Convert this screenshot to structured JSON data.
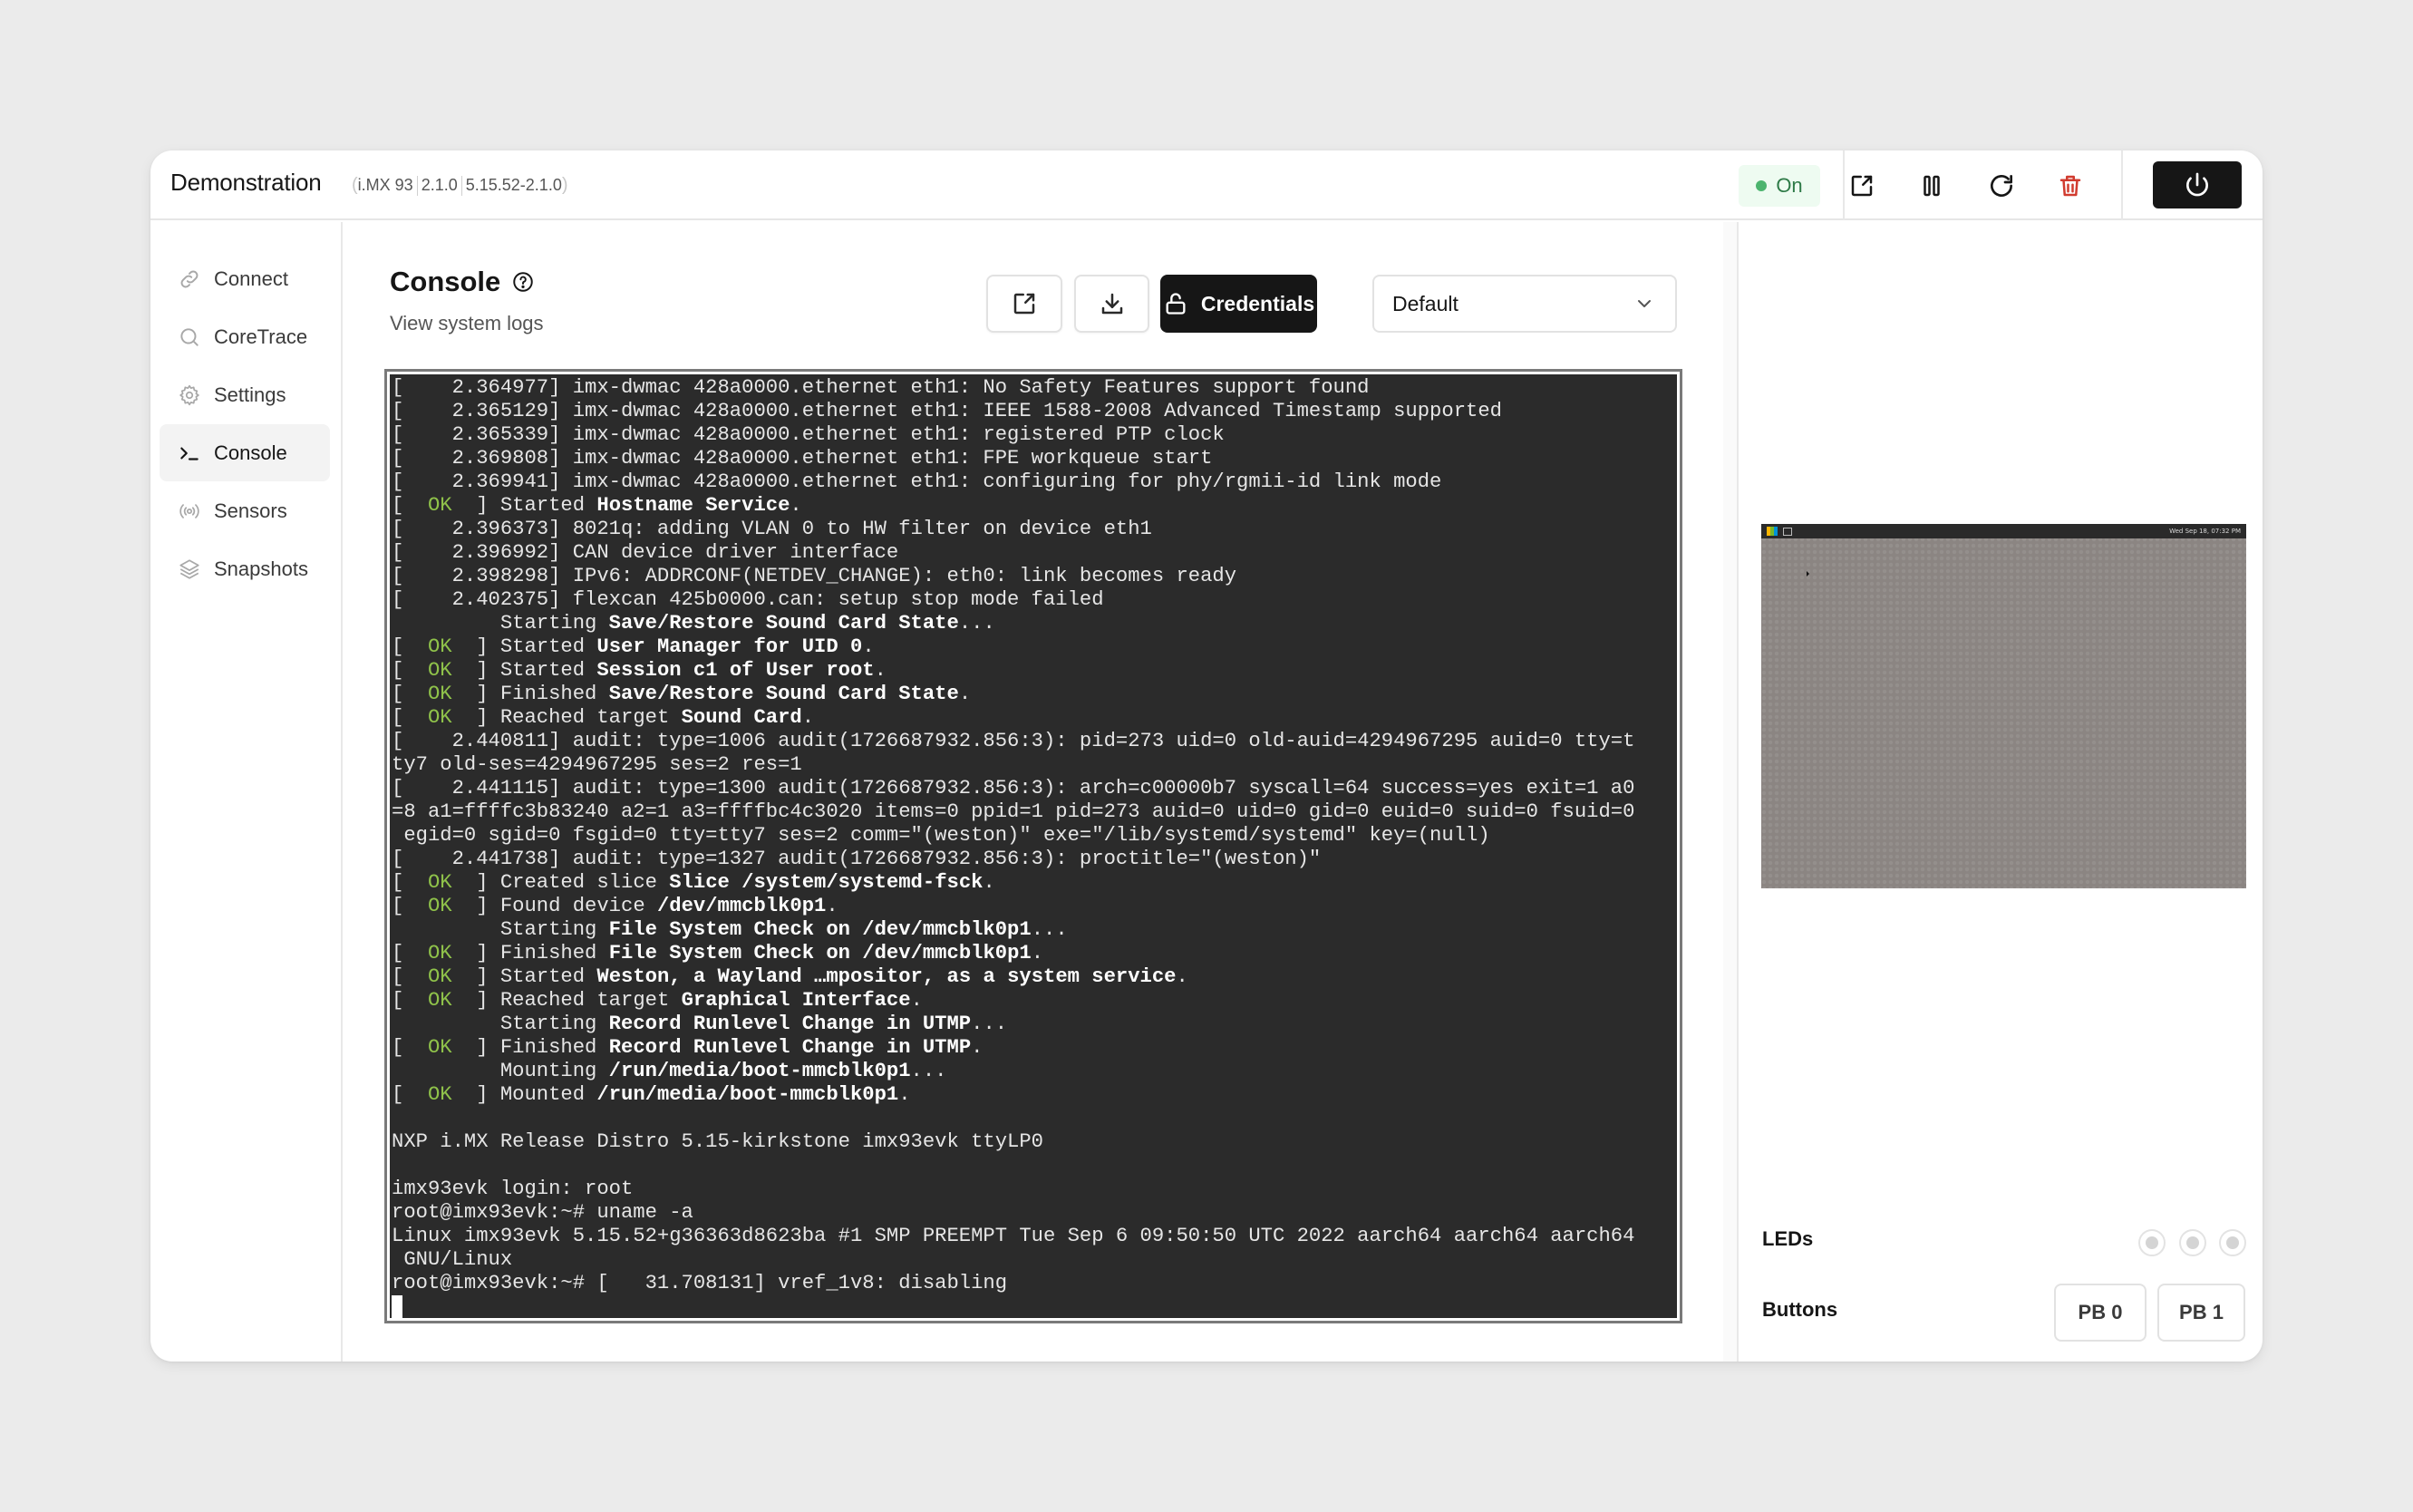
{
  "header": {
    "title": "Demonstration",
    "meta": [
      "i.MX 93",
      "2.1.0",
      "5.15.52-2.1.0"
    ],
    "status": {
      "label": "On",
      "color": "#4cb46e"
    },
    "actions": [
      {
        "name": "open-external",
        "icon": "external-link-icon"
      },
      {
        "name": "pause",
        "icon": "pause-icon"
      },
      {
        "name": "restart",
        "icon": "refresh-icon"
      },
      {
        "name": "delete",
        "icon": "trash-icon",
        "color": "#d13b2f"
      }
    ],
    "power_icon": "power-icon"
  },
  "sidebar": {
    "items": [
      {
        "label": "Connect",
        "icon": "link-icon",
        "active": false
      },
      {
        "label": "CoreTrace",
        "icon": "search-icon",
        "active": false
      },
      {
        "label": "Settings",
        "icon": "gear-icon",
        "active": false
      },
      {
        "label": "Console",
        "icon": "terminal-icon",
        "active": true
      },
      {
        "label": "Sensors",
        "icon": "broadcast-icon",
        "active": false
      },
      {
        "label": "Snapshots",
        "icon": "layers-icon",
        "active": false
      }
    ]
  },
  "main": {
    "title": "Console",
    "subtitle": "View system logs",
    "toolbar": {
      "credentials_label": "Credentials",
      "select_value": "Default"
    },
    "terminal": {
      "lines": [
        [
          {
            "t": "[    2.364977] imx-dwmac 428a0000.ethernet eth1: No Safety Features support found"
          }
        ],
        [
          {
            "t": "[    2.365129] imx-dwmac 428a0000.ethernet eth1: IEEE 1588-2008 Advanced Timestamp supported"
          }
        ],
        [
          {
            "t": "[    2.365339] imx-dwmac 428a0000.ethernet eth1: registered PTP clock"
          }
        ],
        [
          {
            "t": "[    2.369808] imx-dwmac 428a0000.ethernet eth1: FPE workqueue start"
          }
        ],
        [
          {
            "t": "[    2.369941] imx-dwmac 428a0000.ethernet eth1: configuring for phy/rgmii-id link mode"
          }
        ],
        [
          {
            "t": "[  "
          },
          {
            "t": "OK",
            "s": "ok"
          },
          {
            "t": "  ] Started "
          },
          {
            "t": "Hostname Service",
            "s": "b"
          },
          {
            "t": "."
          }
        ],
        [
          {
            "t": "[    2.396373] 8021q: adding VLAN 0 to HW filter on device eth1"
          }
        ],
        [
          {
            "t": "[    2.396992] CAN device driver interface"
          }
        ],
        [
          {
            "t": "[    2.398298] IPv6: ADDRCONF(NETDEV_CHANGE): eth0: link becomes ready"
          }
        ],
        [
          {
            "t": "[    2.402375] flexcan 425b0000.can: setup stop mode failed"
          }
        ],
        [
          {
            "t": "         Starting "
          },
          {
            "t": "Save/Restore Sound Card State",
            "s": "b"
          },
          {
            "t": "..."
          }
        ],
        [
          {
            "t": "[  "
          },
          {
            "t": "OK",
            "s": "ok"
          },
          {
            "t": "  ] Started "
          },
          {
            "t": "User Manager for UID 0",
            "s": "b"
          },
          {
            "t": "."
          }
        ],
        [
          {
            "t": "[  "
          },
          {
            "t": "OK",
            "s": "ok"
          },
          {
            "t": "  ] Started "
          },
          {
            "t": "Session c1 of User root",
            "s": "b"
          },
          {
            "t": "."
          }
        ],
        [
          {
            "t": "[  "
          },
          {
            "t": "OK",
            "s": "ok"
          },
          {
            "t": "  ] Finished "
          },
          {
            "t": "Save/Restore Sound Card State",
            "s": "b"
          },
          {
            "t": "."
          }
        ],
        [
          {
            "t": "[  "
          },
          {
            "t": "OK",
            "s": "ok"
          },
          {
            "t": "  ] Reached target "
          },
          {
            "t": "Sound Card",
            "s": "b"
          },
          {
            "t": "."
          }
        ],
        [
          {
            "t": "[    2.440811] audit: type=1006 audit(1726687932.856:3): pid=273 uid=0 old-auid=4294967295 auid=0 tty=t"
          }
        ],
        [
          {
            "t": "ty7 old-ses=4294967295 ses=2 res=1"
          }
        ],
        [
          {
            "t": "[    2.441115] audit: type=1300 audit(1726687932.856:3): arch=c00000b7 syscall=64 success=yes exit=1 a0"
          }
        ],
        [
          {
            "t": "=8 a1=ffffc3b83240 a2=1 a3=ffffbc4c3020 items=0 ppid=1 pid=273 auid=0 uid=0 gid=0 euid=0 suid=0 fsuid=0"
          }
        ],
        [
          {
            "t": " egid=0 sgid=0 fsgid=0 tty=tty7 ses=2 comm=\"(weston)\" exe=\"/lib/systemd/systemd\" key=(null)"
          }
        ],
        [
          {
            "t": "[    2.441738] audit: type=1327 audit(1726687932.856:3): proctitle=\"(weston)\""
          }
        ],
        [
          {
            "t": "[  "
          },
          {
            "t": "OK",
            "s": "ok"
          },
          {
            "t": "  ] Created slice "
          },
          {
            "t": "Slice /system/systemd-fsck",
            "s": "b"
          },
          {
            "t": "."
          }
        ],
        [
          {
            "t": "[  "
          },
          {
            "t": "OK",
            "s": "ok"
          },
          {
            "t": "  ] Found device "
          },
          {
            "t": "/dev/mmcblk0p1",
            "s": "b"
          },
          {
            "t": "."
          }
        ],
        [
          {
            "t": "         Starting "
          },
          {
            "t": "File System Check on /dev/mmcblk0p1",
            "s": "b"
          },
          {
            "t": "..."
          }
        ],
        [
          {
            "t": "[  "
          },
          {
            "t": "OK",
            "s": "ok"
          },
          {
            "t": "  ] Finished "
          },
          {
            "t": "File System Check on /dev/mmcblk0p1",
            "s": "b"
          },
          {
            "t": "."
          }
        ],
        [
          {
            "t": "[  "
          },
          {
            "t": "OK",
            "s": "ok"
          },
          {
            "t": "  ] Started "
          },
          {
            "t": "Weston, a Wayland …mpositor, as a system service",
            "s": "b"
          },
          {
            "t": "."
          }
        ],
        [
          {
            "t": "[  "
          },
          {
            "t": "OK",
            "s": "ok"
          },
          {
            "t": "  ] Reached target "
          },
          {
            "t": "Graphical Interface",
            "s": "b"
          },
          {
            "t": "."
          }
        ],
        [
          {
            "t": "         Starting "
          },
          {
            "t": "Record Runlevel Change in UTMP",
            "s": "b"
          },
          {
            "t": "..."
          }
        ],
        [
          {
            "t": "[  "
          },
          {
            "t": "OK",
            "s": "ok"
          },
          {
            "t": "  ] Finished "
          },
          {
            "t": "Record Runlevel Change in UTMP",
            "s": "b"
          },
          {
            "t": "."
          }
        ],
        [
          {
            "t": "         Mounting "
          },
          {
            "t": "/run/media/boot-mmcblk0p1",
            "s": "b"
          },
          {
            "t": "..."
          }
        ],
        [
          {
            "t": "[  "
          },
          {
            "t": "OK",
            "s": "ok"
          },
          {
            "t": "  ] Mounted "
          },
          {
            "t": "/run/media/boot-mmcblk0p1",
            "s": "b"
          },
          {
            "t": "."
          }
        ],
        [
          {
            "t": ""
          }
        ],
        [
          {
            "t": "NXP i.MX Release Distro 5.15-kirkstone imx93evk ttyLP0"
          }
        ],
        [
          {
            "t": ""
          }
        ],
        [
          {
            "t": "imx93evk login: root"
          }
        ],
        [
          {
            "t": "root@imx93evk:~# uname -a"
          }
        ],
        [
          {
            "t": "Linux imx93evk 5.15.52+g36363d8623ba #1 SMP PREEMPT Tue Sep 6 09:50:50 UTC 2022 aarch64 aarch64 aarch64"
          }
        ],
        [
          {
            "t": " GNU/Linux"
          }
        ],
        [
          {
            "t": "root@imx93evk:~# [   31.708131] vref_1v8: disabling"
          }
        ]
      ],
      "colors": {
        "background": "#2b2b2b",
        "text": "#e6e6e6",
        "ok": "#8fc24a"
      }
    }
  },
  "right_panel": {
    "screen_preview": {
      "clock": "Wed Sep 18, 07:32 PM"
    },
    "leds_label": "LEDs",
    "leds": [
      {
        "state": "off"
      },
      {
        "state": "off"
      },
      {
        "state": "off"
      }
    ],
    "buttons_label": "Buttons",
    "buttons": [
      {
        "label": "PB 0"
      },
      {
        "label": "PB 1"
      }
    ]
  }
}
